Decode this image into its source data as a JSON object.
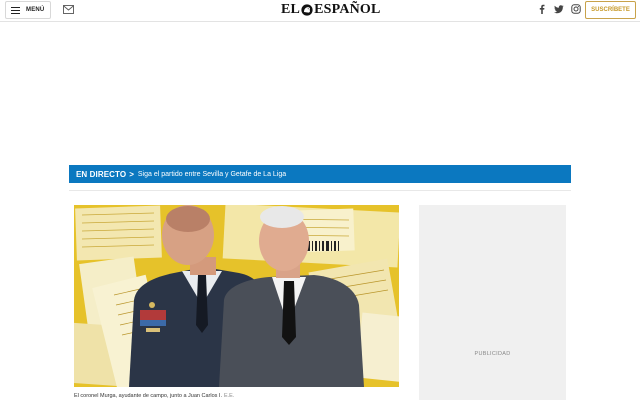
{
  "header": {
    "menu_label": "MENÚ",
    "logo_left": "EL",
    "logo_right": "ESPAÑOL",
    "subscribe_label": "SUSCRÍBETE",
    "icons": [
      "menu-icon",
      "mail-icon",
      "facebook-icon",
      "twitter-icon",
      "instagram-icon"
    ]
  },
  "live": {
    "tag": "EN DIRECTO",
    "arrow": ">",
    "text": "Siga el partido entre Sevilla y Getafe de La Liga"
  },
  "article": {
    "caption": "El coronel Murga, ayudante de campo, junto a Juan Carlos I.",
    "credit": "E.E."
  },
  "ad": {
    "label": "PUBLICIDAD"
  },
  "colors": {
    "live_bar": "#0b78c0",
    "subscribe": "#c79a2a",
    "hero_background": "#e8c62d"
  }
}
